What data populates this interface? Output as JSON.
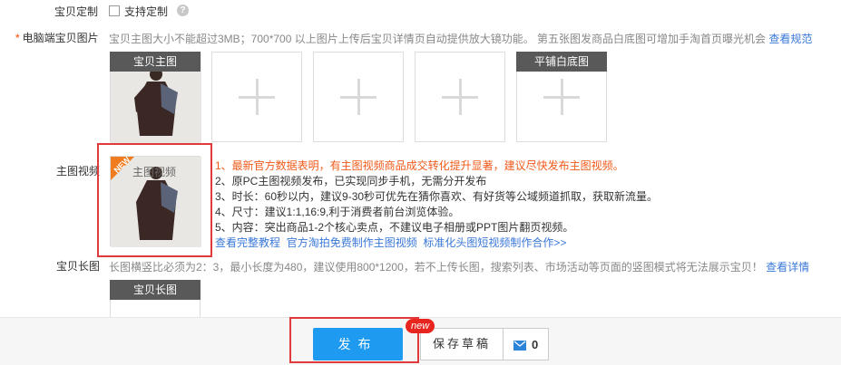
{
  "custom": {
    "label": "宝贝定制",
    "checkbox_label": "支持定制",
    "help": "?"
  },
  "pc_images": {
    "required_mark": "*",
    "label": "电脑端宝贝图片",
    "hint": "宝贝主图大小不能超过3MB；700*700 以上图片上传后宝贝详情页自动提供放大镜功能。 第五张图发商品白底图可增加手淘首页曝光机会",
    "hint_link": "查看规范",
    "main_slot_label": "宝贝主图",
    "white_slot_label": "平铺白底图"
  },
  "video": {
    "label": "主图视频",
    "slot_label": "主图视频",
    "badge": "NEW",
    "tips": [
      "1、最新官方数据表明，有主图视频商品成交转化提升显著，建议尽快发布主图视频。",
      "2、原PC主图视频发布，已实现同步手机，无需分开发布",
      "3、时长：60秒以内，建议9-30秒可优先在猜你喜欢、有好货等公域频道抓取，获取新流量。",
      "4、尺寸：建议1:1,16:9,利于消费者前台浏览体验。",
      "5、内容：突出商品1-2个核心卖点，不建议电子相册或PPT图片翻页视频。"
    ],
    "links": [
      "查看完整教程",
      "官方淘拍免费制作主图视频",
      "标准化头图短视频制作合作>>"
    ]
  },
  "long_image": {
    "label": "宝贝长图",
    "hint": "长图横竖比必须为2：3，最小长度为480，建议使用800*1200，若不上传长图，搜索列表、市场活动等页面的竖图模式将无法展示宝贝！",
    "hint_link": "查看详情",
    "slot_label": "宝贝长图"
  },
  "footer": {
    "publish": "发布",
    "draft": "保存草稿",
    "new_badge": "new",
    "message_count": "0"
  },
  "colors": {
    "accent": "#1e9bf0",
    "warning": "#f05a1a",
    "link": "#3a78d8",
    "highlight": "#e03a3a"
  }
}
